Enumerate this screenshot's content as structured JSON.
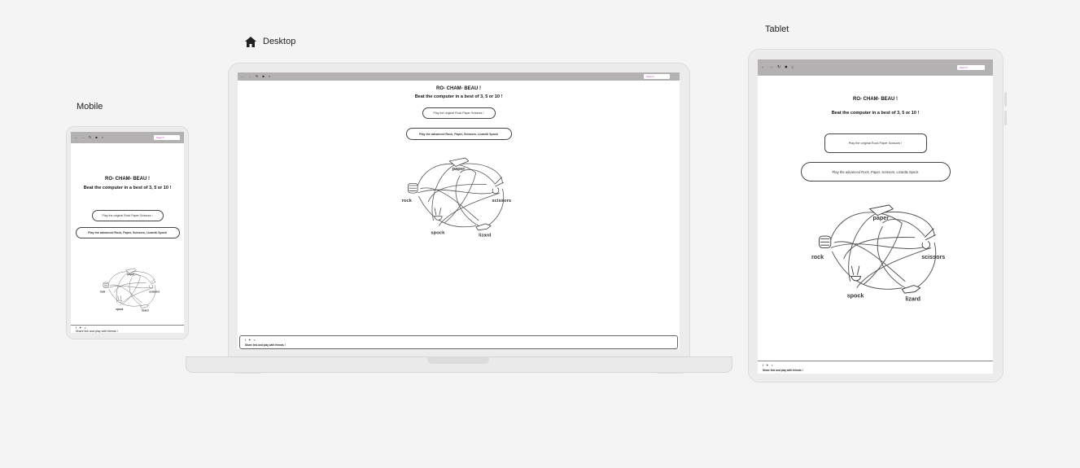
{
  "frames": {
    "mobile": "Mobile",
    "desktop": "Desktop",
    "tablet": "Tablet"
  },
  "browser": {
    "search_placeholder": "Search"
  },
  "game": {
    "title": "RO- CHAM- BEAU !",
    "subtitle": "Beat the computer in a best of 3, 5 or 10 !",
    "classic_button": "Play the original Rock Paper Scissors !",
    "advanced_button": "Play the advanced Rock, Paper, Scissors, Lizard& Spock"
  },
  "diagram": {
    "rock": "rock",
    "paper": "paper",
    "scissors": "scissors",
    "lizard": "lizard",
    "spock": "spock"
  },
  "footer": {
    "share_text": "Share link and play with friends !",
    "icons": [
      "facebook-icon",
      "twitter-icon",
      "share-icon"
    ]
  }
}
